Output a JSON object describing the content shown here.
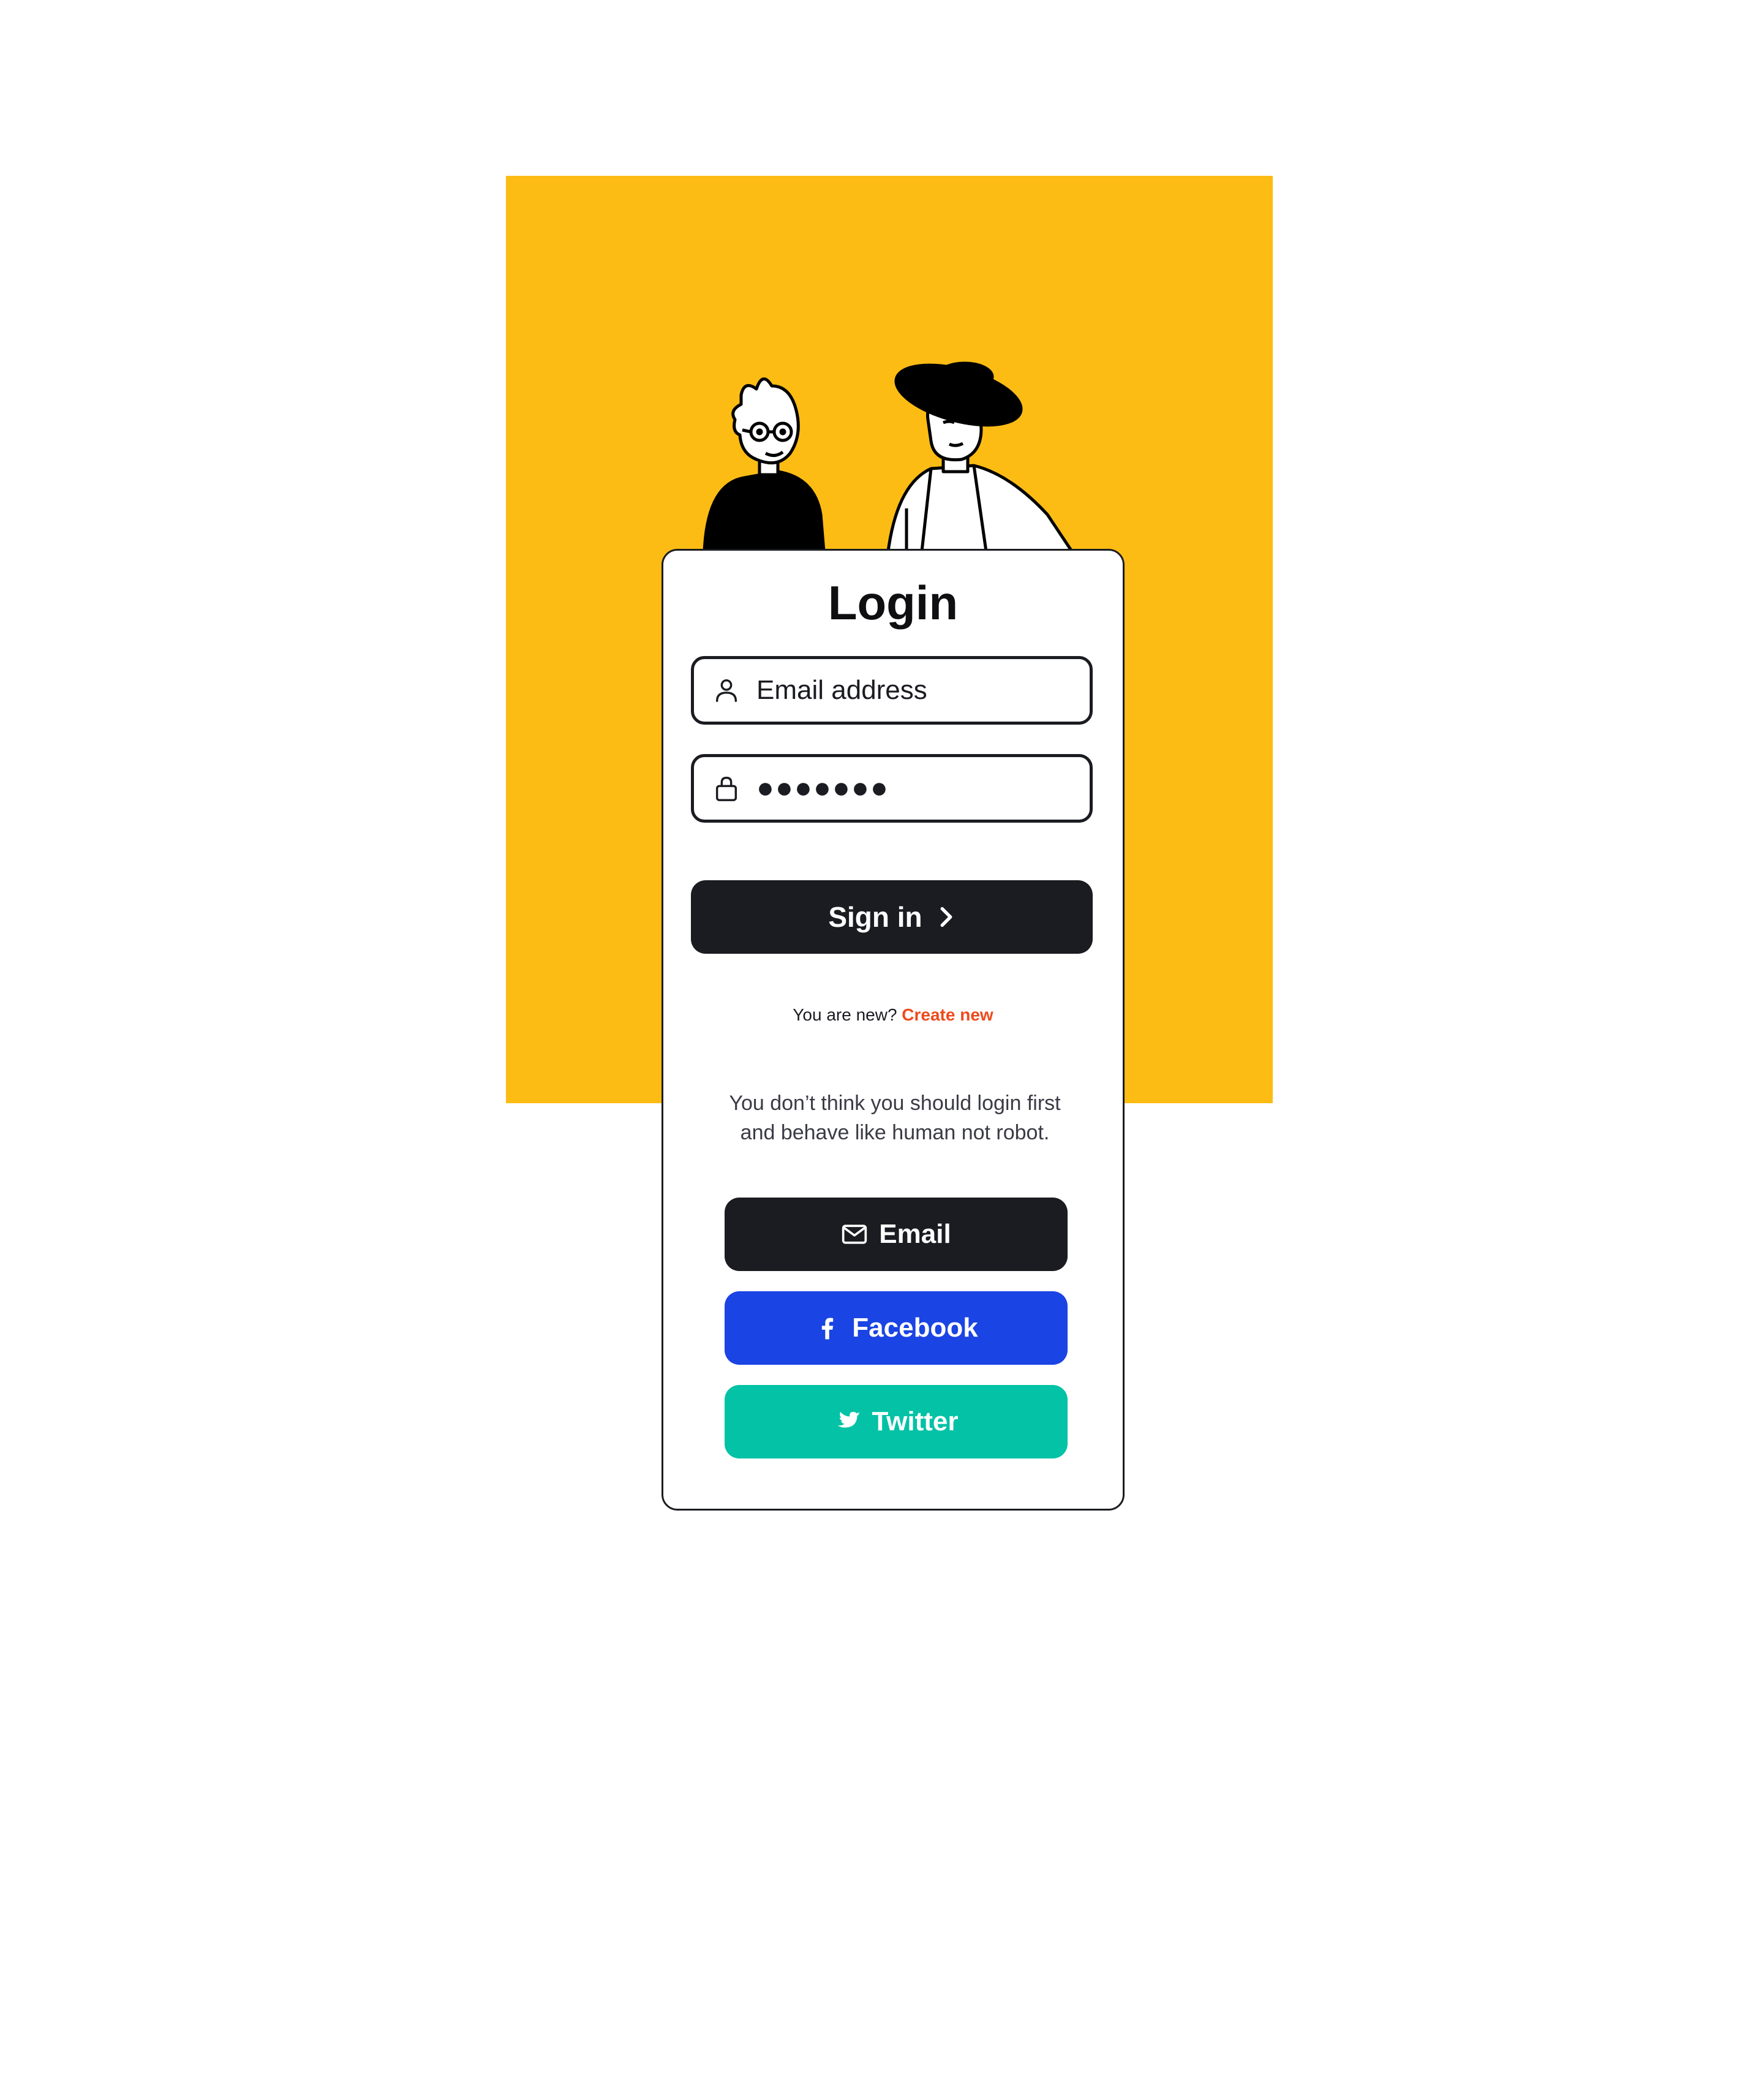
{
  "login": {
    "title": "Login",
    "email_placeholder": "Email address",
    "password_value": "●●●●●●●",
    "signin_label": "Sign in"
  },
  "signup": {
    "prompt": "You are new?",
    "link": "Create new"
  },
  "social": {
    "blurb": "You don’t think you should login first and behave like human not robot.",
    "email_label": "Email",
    "facebook_label": "Facebook",
    "twitter_label": "Twitter"
  },
  "colors": {
    "background_panel": "#FDBC14",
    "dark": "#1B1C21",
    "link": "#EE4A1C",
    "facebook": "#1A44E3",
    "twitter": "#03C2A6"
  },
  "icons": [
    "user-icon",
    "lock-icon",
    "chevron-right-icon",
    "mail-icon",
    "facebook-icon",
    "twitter-icon"
  ]
}
